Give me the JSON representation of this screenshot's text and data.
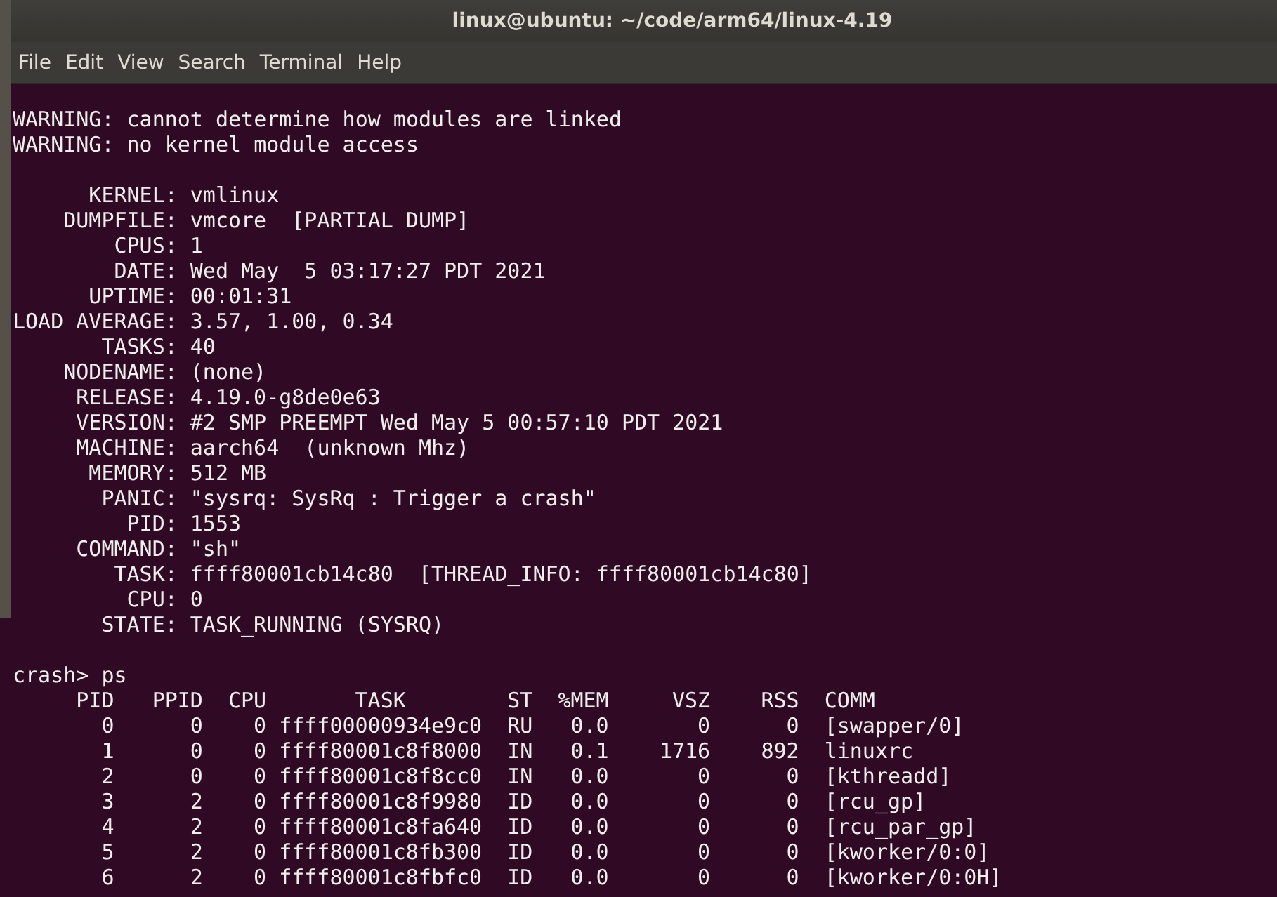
{
  "window": {
    "title": "linux@ubuntu: ~/code/arm64/linux-4.19"
  },
  "menu": [
    "File",
    "Edit",
    "View",
    "Search",
    "Terminal",
    "Help"
  ],
  "terminal": {
    "warnings": [
      "WARNING: cannot determine how modules are linked",
      "WARNING: no kernel module access"
    ],
    "info": [
      {
        "label": "KERNEL:",
        "value": "vmlinux"
      },
      {
        "label": "DUMPFILE:",
        "value": "vmcore  [PARTIAL DUMP]"
      },
      {
        "label": "CPUS:",
        "value": "1"
      },
      {
        "label": "DATE:",
        "value": "Wed May  5 03:17:27 PDT 2021"
      },
      {
        "label": "UPTIME:",
        "value": "00:01:31"
      },
      {
        "label": "LOAD AVERAGE:",
        "value": "3.57, 1.00, 0.34"
      },
      {
        "label": "TASKS:",
        "value": "40"
      },
      {
        "label": "NODENAME:",
        "value": "(none)"
      },
      {
        "label": "RELEASE:",
        "value": "4.19.0-g8de0e63"
      },
      {
        "label": "VERSION:",
        "value": "#2 SMP PREEMPT Wed May 5 00:57:10 PDT 2021"
      },
      {
        "label": "MACHINE:",
        "value": "aarch64  (unknown Mhz)"
      },
      {
        "label": "MEMORY:",
        "value": "512 MB"
      },
      {
        "label": "PANIC:",
        "value": "\"sysrq: SysRq : Trigger a crash\""
      },
      {
        "label": "PID:",
        "value": "1553"
      },
      {
        "label": "COMMAND:",
        "value": "\"sh\""
      },
      {
        "label": "TASK:",
        "value": "ffff80001cb14c80  [THREAD_INFO: ffff80001cb14c80]"
      },
      {
        "label": "CPU:",
        "value": "0"
      },
      {
        "label": "STATE:",
        "value": "TASK_RUNNING (SYSRQ)"
      }
    ],
    "prompt": "crash> ps",
    "ps_table": {
      "columns": [
        "PID",
        "PPID",
        "CPU",
        "TASK",
        "ST",
        "%MEM",
        "VSZ",
        "RSS",
        "COMM"
      ],
      "rows": [
        [
          "0",
          "0",
          "0",
          "ffff00000934e9c0",
          "RU",
          "0.0",
          "0",
          "0",
          "[swapper/0]"
        ],
        [
          "1",
          "0",
          "0",
          "ffff80001c8f8000",
          "IN",
          "0.1",
          "1716",
          "892",
          "linuxrc"
        ],
        [
          "2",
          "0",
          "0",
          "ffff80001c8f8cc0",
          "IN",
          "0.0",
          "0",
          "0",
          "[kthreadd]"
        ],
        [
          "3",
          "2",
          "0",
          "ffff80001c8f9980",
          "ID",
          "0.0",
          "0",
          "0",
          "[rcu_gp]"
        ],
        [
          "4",
          "2",
          "0",
          "ffff80001c8fa640",
          "ID",
          "0.0",
          "0",
          "0",
          "[rcu_par_gp]"
        ],
        [
          "5",
          "2",
          "0",
          "ffff80001c8fb300",
          "ID",
          "0.0",
          "0",
          "0",
          "[kworker/0:0]"
        ],
        [
          "6",
          "2",
          "0",
          "ffff80001c8fbfc0",
          "ID",
          "0.0",
          "0",
          "0",
          "[kworker/0:0H]"
        ]
      ]
    }
  }
}
